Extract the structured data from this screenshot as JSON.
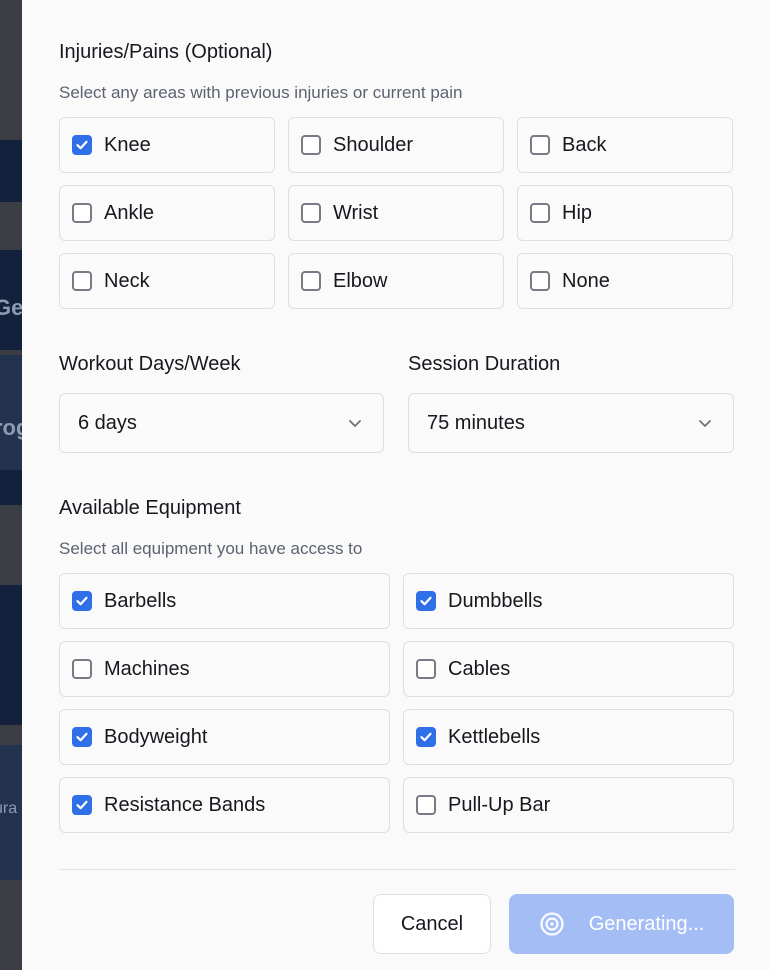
{
  "background_page": {
    "fragments": [
      "Ge",
      "rog",
      "ura"
    ]
  },
  "injuries": {
    "title": "Injuries/Pains (Optional)",
    "subtitle": "Select any areas with previous injuries or current pain",
    "options": [
      {
        "label": "Knee",
        "checked": true
      },
      {
        "label": "Shoulder",
        "checked": false
      },
      {
        "label": "Back",
        "checked": false
      },
      {
        "label": "Ankle",
        "checked": false
      },
      {
        "label": "Wrist",
        "checked": false
      },
      {
        "label": "Hip",
        "checked": false
      },
      {
        "label": "Neck",
        "checked": false
      },
      {
        "label": "Elbow",
        "checked": false
      },
      {
        "label": "None",
        "checked": false
      }
    ]
  },
  "workout_days": {
    "label": "Workout Days/Week",
    "value": "6 days"
  },
  "session_duration": {
    "label": "Session Duration",
    "value": "75 minutes"
  },
  "equipment": {
    "title": "Available Equipment",
    "subtitle": "Select all equipment you have access to",
    "options": [
      {
        "label": "Barbells",
        "checked": true
      },
      {
        "label": "Dumbbells",
        "checked": true
      },
      {
        "label": "Machines",
        "checked": false
      },
      {
        "label": "Cables",
        "checked": false
      },
      {
        "label": "Bodyweight",
        "checked": true
      },
      {
        "label": "Kettlebells",
        "checked": true
      },
      {
        "label": "Resistance Bands",
        "checked": true
      },
      {
        "label": "Pull-Up Bar",
        "checked": false
      }
    ]
  },
  "footer": {
    "cancel_label": "Cancel",
    "generate_label": "Generating..."
  },
  "colors": {
    "accent": "#2f6fe8",
    "generate_button": "#a5bdf5"
  }
}
